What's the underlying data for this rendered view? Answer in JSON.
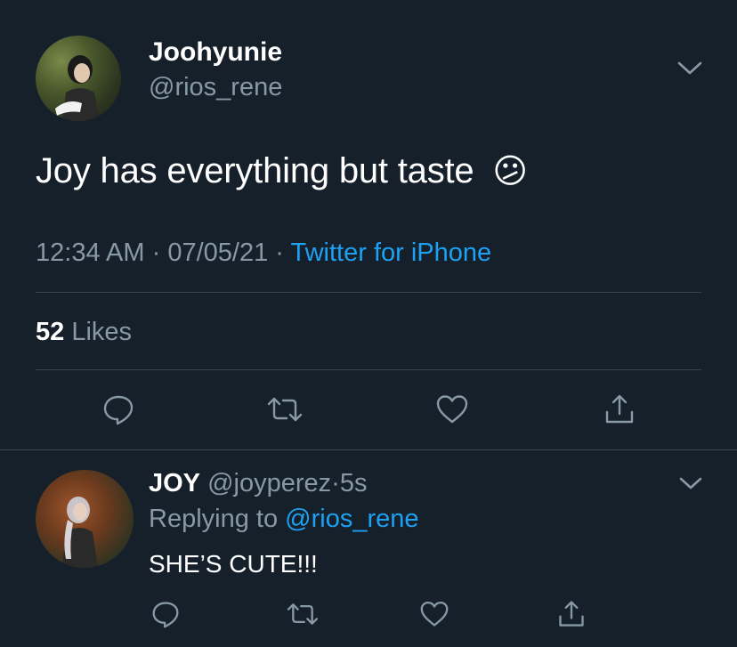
{
  "tweet": {
    "author_name": "Joohyunie",
    "author_handle": "@rios_rene",
    "text": "Joy has everything but taste",
    "emoji": "😕",
    "time": "12:34 AM",
    "sep1": "·",
    "date": "07/05/21",
    "sep2": "·",
    "source": "Twitter for iPhone",
    "likes_count": "52",
    "likes_label": "Likes"
  },
  "reply": {
    "author_name": "JOY",
    "author_handle": "@joyperez",
    "sep": "·",
    "age": "5s",
    "replying_prefix": "Replying to",
    "replying_to": "@rios_rene",
    "text": "SHE’S CUTE!!!"
  },
  "colors": {
    "background": "#15202b",
    "secondary_text": "#8899a6",
    "link": "#1da1f2",
    "divider": "#38444d"
  },
  "icons": [
    "chevron-down-icon",
    "reply-icon",
    "retweet-icon",
    "like-icon",
    "share-icon"
  ]
}
